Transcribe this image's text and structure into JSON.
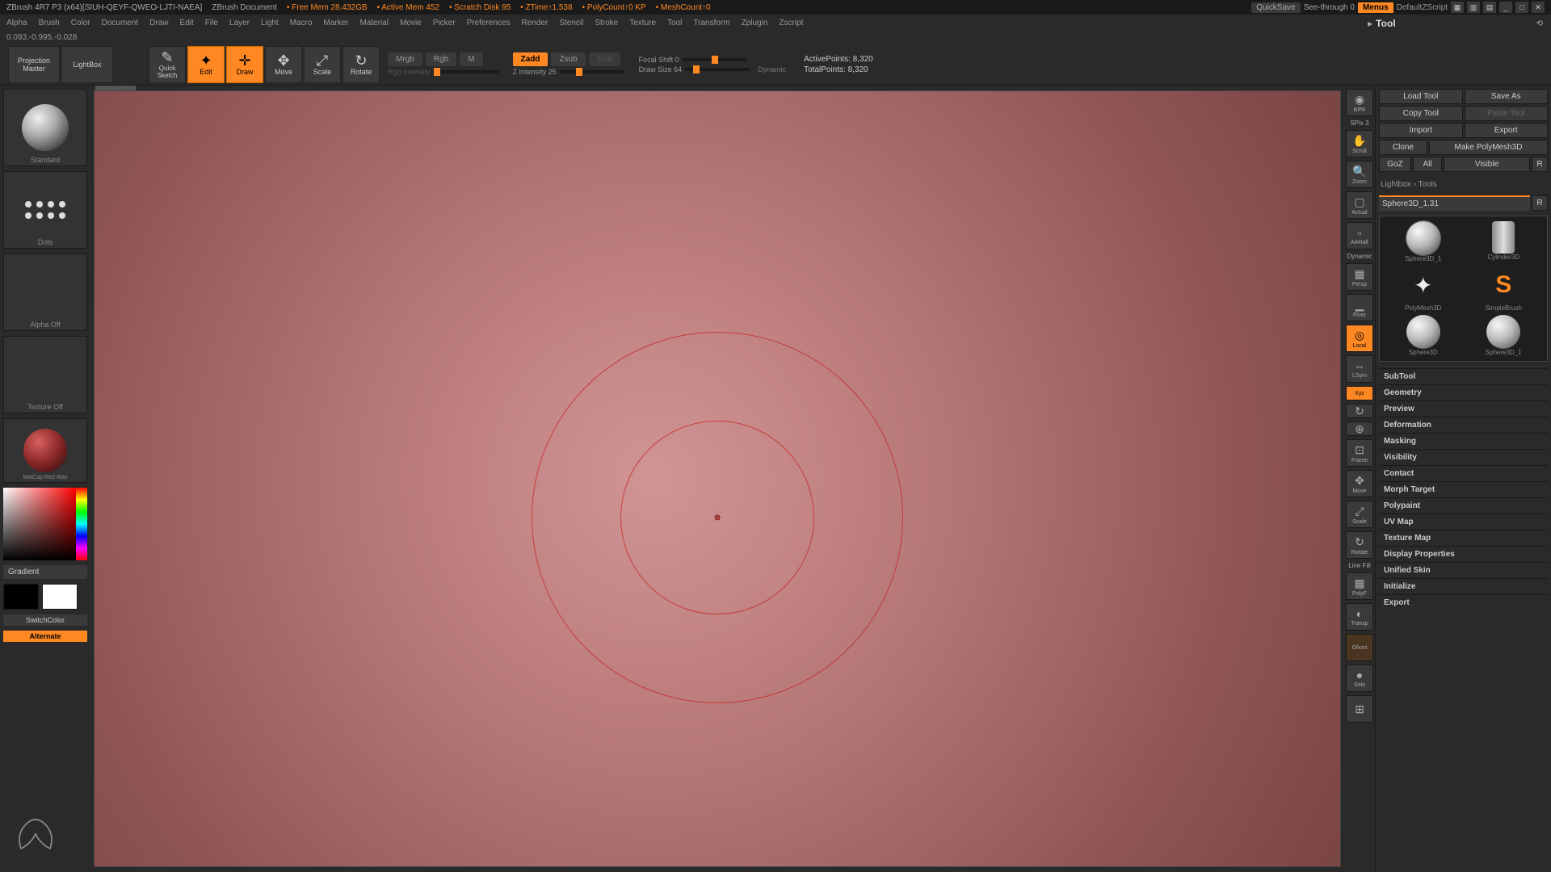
{
  "title_bar": {
    "app": "ZBrush 4R7 P3 (x64)[SIUH-QEYF-QWEO-LJTI-NAEA]",
    "doc": "ZBrush Document",
    "free_mem": "Free Mem 28.432GB",
    "active_mem": "Active Mem 452",
    "scratch": "Scratch Disk 95",
    "ztime": "ZTime↑1.538",
    "polycount": "PolyCount↑0 KP",
    "meshcount": "MeshCount↑0",
    "quicksave": "QuickSave",
    "seethrough": "See-through  0",
    "menus": "Menus",
    "script": "DefaultZScript"
  },
  "menu": [
    "Alpha",
    "Brush",
    "Color",
    "Document",
    "Draw",
    "Edit",
    "File",
    "Layer",
    "Light",
    "Macro",
    "Marker",
    "Material",
    "Movie",
    "Picker",
    "Preferences",
    "Render",
    "Stencil",
    "Stroke",
    "Texture",
    "Tool",
    "Transform",
    "Zplugin",
    "Zscript"
  ],
  "coords": "0.093,-0.995,-0.028",
  "toolbar": {
    "projection": "Projection\nMaster",
    "lightbox": "LightBox",
    "quicksketch": "Quick\nSketch",
    "edit": "Edit",
    "draw": "Draw",
    "move": "Move",
    "scale": "Scale",
    "rotate": "Rotate",
    "mrgb": "Mrgb",
    "rgb": "Rgb",
    "m": "M",
    "rgb_int_label": "Rgb Intensity",
    "zadd": "Zadd",
    "zsub": "Zsub",
    "zcut": "Zcut",
    "zint_label": "Z Intensity 25",
    "focal_label": "Focal Shift 0",
    "drawsize_label": "Draw Size 64",
    "dynamic": "Dynamic",
    "active_pts": "ActivePoints: 8,320",
    "total_pts": "TotalPoints: 8,320"
  },
  "left": {
    "brush_label": "Standard",
    "stroke_label": "Dots",
    "alpha_label": "Alpha Off",
    "texture_label": "Texture Off",
    "material_label": "MatCap Red Wax",
    "gradient": "Gradient",
    "switch": "SwitchColor",
    "alternate": "Alternate"
  },
  "nav": {
    "bpr": "BPR",
    "spix": "SPix 3",
    "scroll": "Scroll",
    "zoom": "Zoom",
    "actual": "Actual",
    "aahalf": "AAHalf",
    "dynamic": "Dynamic",
    "persp": "Persp",
    "floor": "Floor",
    "local": "Local",
    "lsym": "LSym",
    "xyz": "Xyz",
    "frame": "Frame",
    "move": "Move",
    "scale": "Scale",
    "rotate": "Rotate",
    "linefill": "Line Fill",
    "polyf": "PolyF",
    "transp": "Transp",
    "ghost": "Ghost",
    "solo": "Solo"
  },
  "panel": {
    "title": "Tool",
    "load": "Load Tool",
    "save": "Save As",
    "copy": "Copy Tool",
    "paste": "Paste Tool",
    "import": "Import",
    "export": "Export",
    "clone": "Clone",
    "makepm": "Make PolyMesh3D",
    "goz": "GoZ",
    "all": "All",
    "visible": "Visible",
    "r": "R",
    "lightbox_tools": "Lightbox › Tools",
    "current_tool": "Sphere3D_1.31",
    "tools": [
      {
        "name": "Sphere3D_1",
        "type": "sphere"
      },
      {
        "name": "Cylinder3D",
        "type": "cylinder"
      },
      {
        "name": "PolyMesh3D",
        "type": "star"
      },
      {
        "name": "SimpleBrush",
        "type": "sbrush"
      },
      {
        "name": "Sphere3D",
        "type": "sphere"
      },
      {
        "name": "Sphere3D_1",
        "type": "sphere"
      }
    ],
    "sections": [
      "SubTool",
      "Geometry",
      "Preview",
      "Deformation",
      "Masking",
      "Visibility",
      "Contact",
      "Morph Target",
      "Polypaint",
      "UV Map",
      "Texture Map",
      "Display Properties",
      "Unified Skin",
      "Initialize",
      "Export"
    ]
  }
}
